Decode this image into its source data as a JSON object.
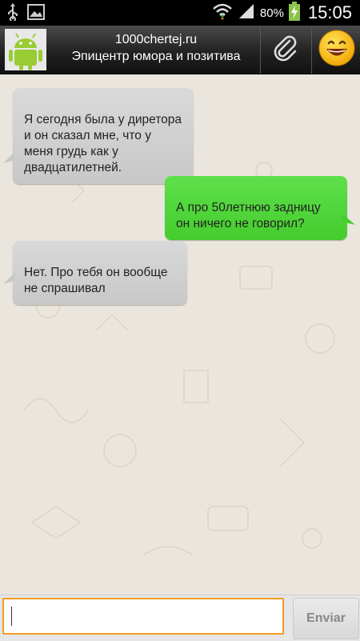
{
  "status_bar": {
    "battery_percent": "80%",
    "time": "15:05",
    "icons": [
      "usb-icon",
      "image-icon",
      "wifi-icon",
      "signal-icon",
      "battery-charging-icon"
    ]
  },
  "header": {
    "title": "1000chertej.ru",
    "subtitle": "Эпицентр юмора и позитива",
    "icons": [
      "android-avatar-icon",
      "paperclip-icon",
      "smiley-icon"
    ]
  },
  "messages": [
    {
      "direction": "incoming",
      "text": "Я сегодня была у диретора\nи он сказал мне, что у\nменя грудь как у\nдвадцатилетней."
    },
    {
      "direction": "outgoing",
      "text": "А про 50летнюю задницу\nон ничего не говорил?"
    },
    {
      "direction": "incoming",
      "text": "Нет. Про тебя он вообще\nне спрашивал"
    }
  ],
  "composer": {
    "value": "",
    "send_label": "Enviar"
  },
  "colors": {
    "outgoing_bubble": "#4fd63a",
    "incoming_bubble": "#d0d0d0",
    "input_focus": "#f39c1f"
  }
}
